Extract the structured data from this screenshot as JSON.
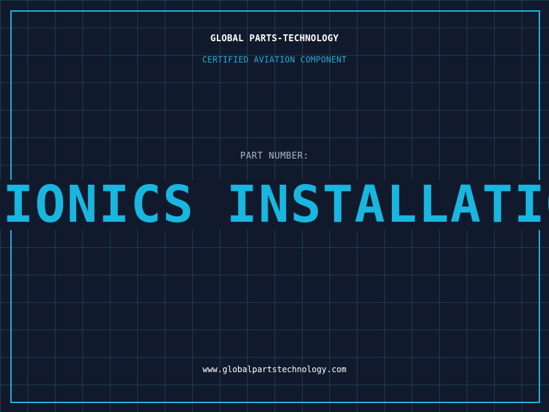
{
  "header": {
    "company": "GLOBAL PARTS-TECHNOLOGY",
    "tagline": "CERTIFIED AVIATION COMPONENT"
  },
  "main": {
    "part_label": "PART NUMBER:",
    "part_number": "AVIONICS INSTALLATION"
  },
  "footer": {
    "website": "www.globalpartstechnology.com"
  },
  "colors": {
    "background": "#111a2c",
    "grid": "#1f5a74",
    "accent": "#1fb6dc",
    "text_primary": "#ffffff",
    "text_muted": "#a9b6c6"
  }
}
